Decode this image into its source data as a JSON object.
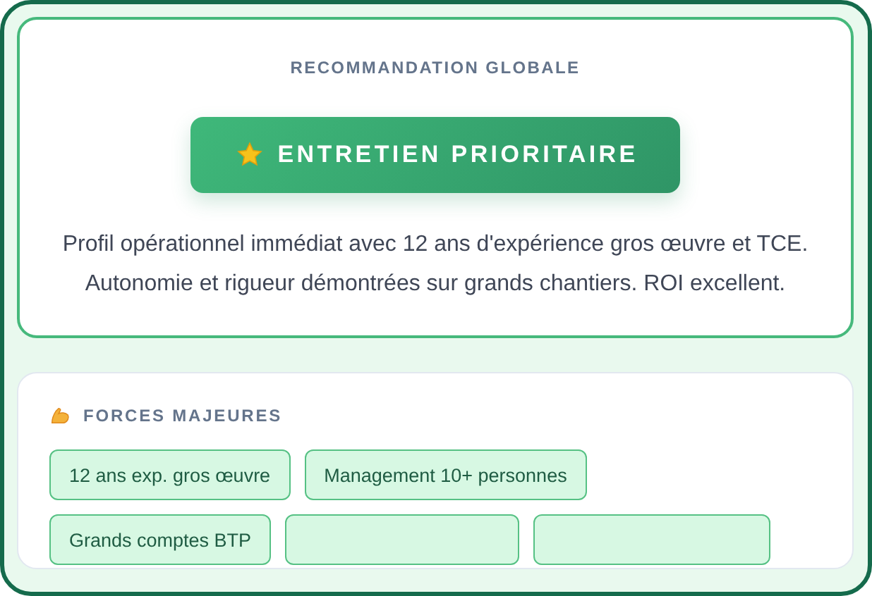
{
  "recommendation": {
    "heading": "RECOMMANDATION GLOBALE",
    "verdict": "ENTRETIEN PRIORITAIRE",
    "summary": "Profil opérationnel immédiat avec 12 ans d'expérience gros œuvre et TCE. Autonomie et rigueur démontrées sur grands chantiers. ROI excellent."
  },
  "strengths": {
    "heading": "FORCES MAJEURES",
    "tags": [
      {
        "label": "12 ans exp. gros œuvre"
      },
      {
        "label": "Management 10+ personnes"
      },
      {
        "label": "Grands comptes BTP"
      }
    ]
  }
}
